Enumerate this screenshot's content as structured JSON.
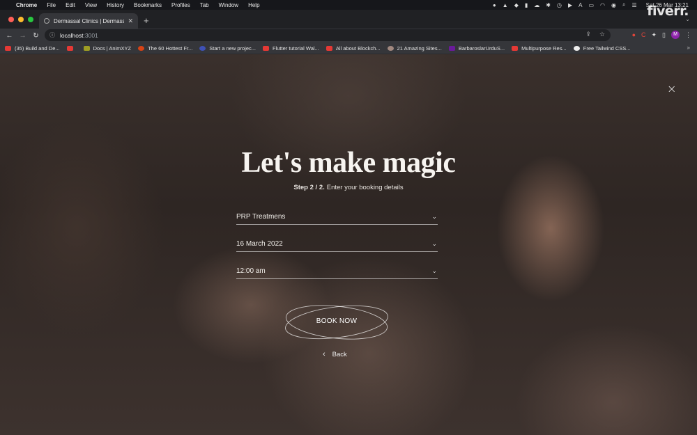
{
  "menubar": {
    "app": "Chrome",
    "items": [
      "File",
      "Edit",
      "View",
      "History",
      "Bookmarks",
      "Profiles",
      "Tab",
      "Window",
      "Help"
    ],
    "clock": "Sat 26 Mar 13:21"
  },
  "watermark": "fiverr.",
  "browser": {
    "tab_title": "Dermassal Clinics | Dermassal",
    "url_host": "localhost",
    "url_port": ":3001",
    "profile_initial": "M",
    "bookmarks": [
      "(35) Build and De...",
      "",
      "Docs | AnimXYZ",
      "The 60 Hottest Fr...",
      "Start a new projec...",
      "Flutter tutorial Wal...",
      "All about Blockch...",
      "21 Amazing Sites...",
      "BarbaroslarUrduS...",
      "Multipurpose Res...",
      "Free Tailwind CSS..."
    ]
  },
  "booking": {
    "close": "×",
    "headline": "Let's make magic",
    "step_bold": "Step 2 / 2.",
    "step_text": "Enter your booking details",
    "treatment": "PRP Treatmens",
    "date": "16 March 2022",
    "time": "12:00 am",
    "book_label": "BOOK NOW",
    "back_label": "Back"
  },
  "colors": {
    "menubar_bg": "#16171b",
    "tabstrip_bg": "#202124",
    "toolbar_bg": "#35363a",
    "text_light": "#f7f4f0"
  },
  "icons": [
    "apple-icon",
    "wifi-icon",
    "battery-icon",
    "search-icon",
    "info-icon",
    "share-icon",
    "star-icon",
    "extensions-icon",
    "sidepanel-icon",
    "close-icon",
    "chevron-down-icon",
    "chevron-left-icon"
  ]
}
